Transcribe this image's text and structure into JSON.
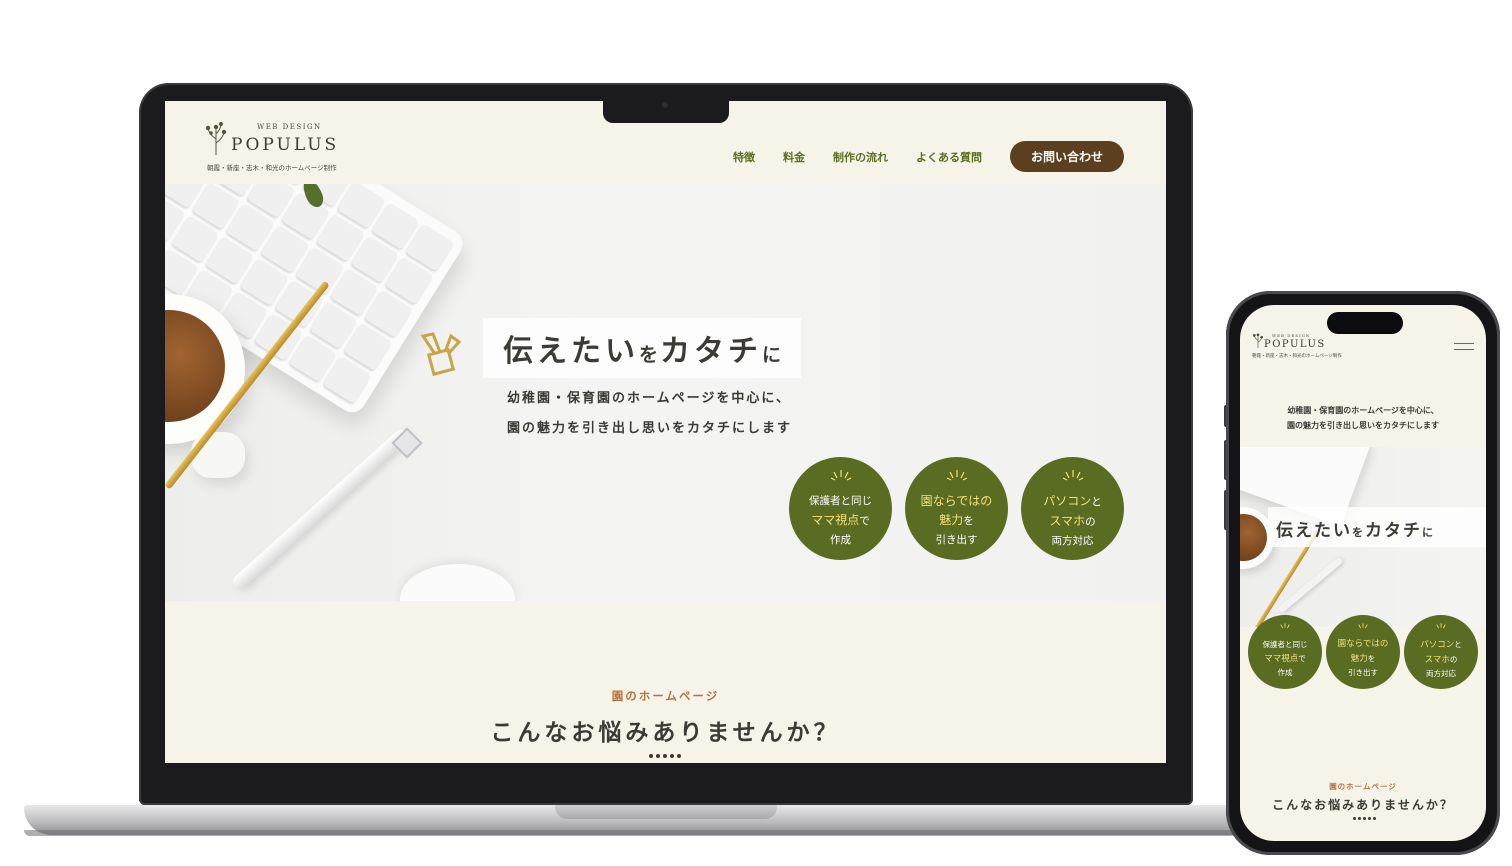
{
  "brand": {
    "small": "WEB DESIGN",
    "name": "POPULUS",
    "tagline": "朝霞・新座・志木・和光のホームページ制作"
  },
  "nav": {
    "items": [
      "特徴",
      "料金",
      "制作の流れ",
      "よくある質問"
    ],
    "cta": "お問い合わせ"
  },
  "hero": {
    "title_a": "伝えたい",
    "title_b": "を",
    "title_c": "カタチ",
    "title_d": "に",
    "lead_1": "幼稚園・保育園のホームページを中心に、",
    "lead_2": "園の魅力を引き出し思いをカタチにします"
  },
  "badges": [
    {
      "line1_a": "保護者",
      "line1_b": "と同じ",
      "line2_a": "ママ視点",
      "line2_b": "で",
      "line3": "作成"
    },
    {
      "line1_a": "園ならではの",
      "line1_b": "",
      "line2_a": "魅力",
      "line2_b": "を",
      "line3": "引き出す"
    },
    {
      "line1_a": "パソコン",
      "line1_b": "と",
      "line2_a": "スマホ",
      "line2_b": "の",
      "line3": "両方対応"
    }
  ],
  "section": {
    "label": "園のホームページ",
    "title": "こんなお悩みありませんか？"
  },
  "colors": {
    "accent_green": "#5a6b22",
    "nav_green": "#5b6f23",
    "cta_brown": "#5c3f1f",
    "label_orange": "#b4743f",
    "page_bg": "#f6f4e8"
  },
  "icons": [
    "sprig-logo-icon",
    "menu-icon",
    "sunburst-icon",
    "binder-clip-icon"
  ]
}
